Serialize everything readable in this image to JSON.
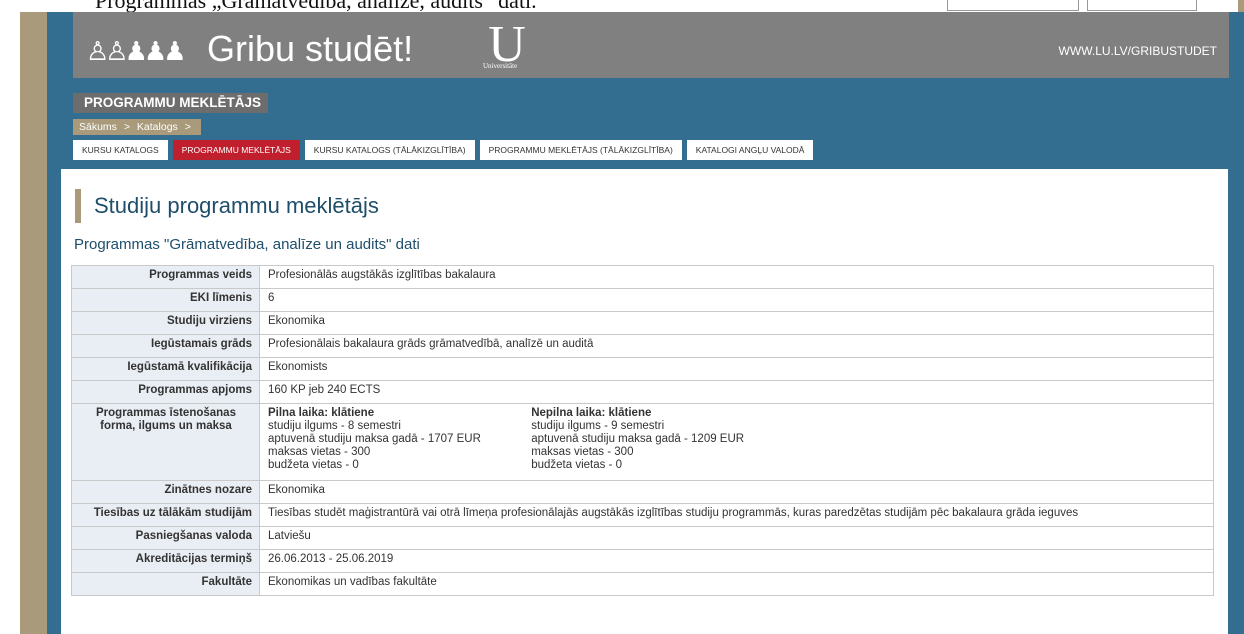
{
  "top_strip": {
    "text": "Programmas „Grāmatvedība, analīze, audits” dati."
  },
  "banner": {
    "title": "Gribu studēt!",
    "logo_letter": "U",
    "logo_caption": "Universitāte",
    "url": "WWW.LU.LV/GRIBUSTUDET"
  },
  "section_label": "PROGRAMMU MEKLĒTĀJS",
  "breadcrumb": {
    "items": [
      "Sākums",
      ">",
      "Katalogs",
      ">"
    ]
  },
  "tabs": [
    {
      "label": "KURSU KATALOGS",
      "active": false
    },
    {
      "label": "PROGRAMMU MEKLĒTĀJS",
      "active": true
    },
    {
      "label": "KURSU KATALOGS (TĀLĀKIZGLĪTĪBA)",
      "active": false
    },
    {
      "label": "PROGRAMMU MEKLĒTĀJS (TĀLĀKIZGLĪTĪBA)",
      "active": false
    },
    {
      "label": "KATALOGI ANGĻU VALODĀ",
      "active": false
    }
  ],
  "page_title": "Studiju programmu meklētājs",
  "subtitle": "Programmas \"Grāmatvedība, analīze un audits\" dati",
  "table": {
    "rows": [
      {
        "label": "Programmas veids",
        "value": "Profesionālās augstākās izglītības bakalaura"
      },
      {
        "label": "EKI līmenis",
        "value": "6"
      },
      {
        "label": "Studiju virziens",
        "value": "Ekonomika"
      },
      {
        "label": "Iegūstamais grāds",
        "value": "Profesionālais bakalaura grāds grāmatvedībā, analīzē un auditā"
      },
      {
        "label": "Iegūstamā kvalifikācija",
        "value": "Ekonomists"
      },
      {
        "label": "Programmas apjoms",
        "value": "160 KP jeb 240 ECTS"
      }
    ],
    "form_row": {
      "label": "Programmas īstenošanas forma, ilgums un maksa",
      "modes": [
        {
          "title": "Pilna laika: klātiene",
          "duration": "studiju ilgums - 8 semestri",
          "fee": "aptuvenā studiju maksa gadā - 1707 EUR",
          "paid_places": "maksas vietas - 300",
          "budget_places": "budžeta vietas - 0"
        },
        {
          "title": "Nepilna laika: klātiene",
          "duration": "studiju ilgums - 9 semestri",
          "fee": "aptuvenā studiju maksa gadā - 1209 EUR",
          "paid_places": "maksas vietas - 300",
          "budget_places": "budžeta vietas - 0"
        }
      ]
    },
    "rows_after": [
      {
        "label": "Zinātnes nozare",
        "value": "Ekonomika"
      },
      {
        "label": "Tiesības uz tālākām studijām",
        "value": "Tiesības studēt maģistrantūrā vai otrā līmeņa profesionālajās augstākās izglītības studiju programmās, kuras paredzētas studijām pēc bakalaura grāda ieguves"
      },
      {
        "label": "Pasniegšanas valoda",
        "value": "Latviešu"
      },
      {
        "label": "Akreditācijas termiņš",
        "value": "26.06.2013 - 25.06.2019"
      },
      {
        "label": "Fakultāte",
        "value": "Ekonomikas un vadības fakultāte"
      }
    ]
  }
}
